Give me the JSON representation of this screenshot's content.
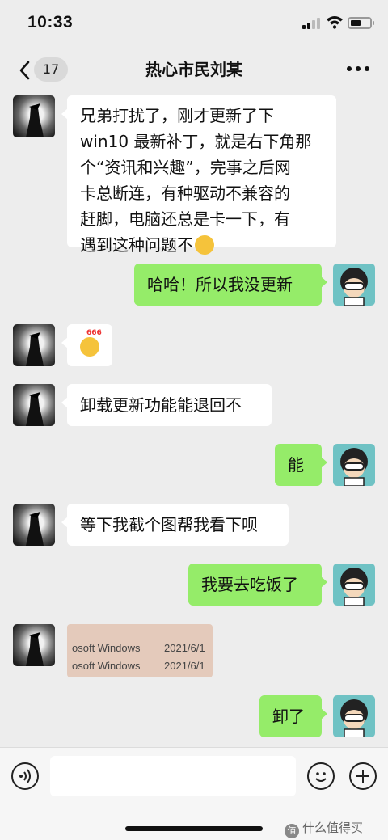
{
  "status_bar": {
    "time": "10:33"
  },
  "nav": {
    "back_count": "17",
    "title": "热心市民刘某"
  },
  "messages": [
    {
      "side": "in",
      "lines": [
        "兄弟打扰了，刚才更新了下",
        "win10 最新补丁，就是右下角那",
        "个“资讯和兴趣”，完事之后网",
        "卡总断连，有种驱动不兼容的",
        "赶脚，电脑还总是卡一下，有",
        "遇到这种问题不"
      ],
      "emoji": "facepalm-emoji"
    },
    {
      "side": "out",
      "text": "哈哈！所以我没更新"
    },
    {
      "side": "in",
      "emoji": "666-emoji",
      "emoji_text": "666"
    },
    {
      "side": "in",
      "text": "卸载更新功能能退回不"
    },
    {
      "side": "out",
      "text": "能"
    },
    {
      "side": "in",
      "text": "等下我截个图帮我看下呗"
    },
    {
      "side": "out",
      "text": "我要去吃饭了"
    },
    {
      "side": "in",
      "image": {
        "rows": [
          {
            "name": "osoft Windows",
            "date": "2021/6/1"
          },
          {
            "name": "osoft Windows",
            "date": "2021/6/1"
          }
        ]
      }
    },
    {
      "side": "out",
      "text": "卸了"
    }
  ],
  "input_bar": {
    "placeholder": ""
  },
  "watermark": {
    "text": "什么值得买",
    "logo": "值"
  },
  "colors": {
    "outgoing_bubble": "#95ec69",
    "incoming_bubble": "#ffffff",
    "background": "#ededed"
  }
}
